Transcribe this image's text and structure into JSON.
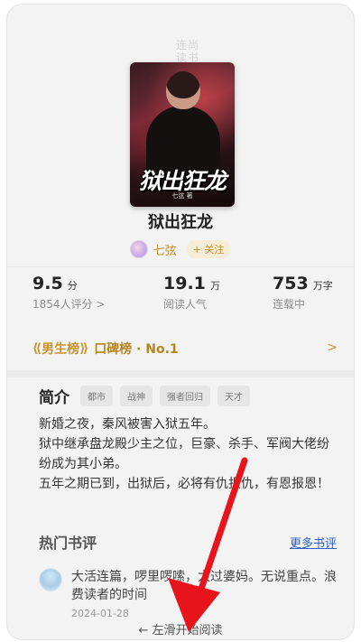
{
  "watermark": {
    "line1": "连尚",
    "line2": "读书"
  },
  "book": {
    "title": "狱出狂龙",
    "cover": {
      "title_art": "狱出狂龙",
      "author_art": "七弦 著"
    },
    "author": "七弦",
    "follow_label": "+ 关注"
  },
  "stats": {
    "rating": {
      "value": "9.5",
      "unit": "分",
      "label": "1854人评分 >"
    },
    "readers": {
      "value": "19.1",
      "unit": "万",
      "label": "阅读人气"
    },
    "words": {
      "value": "753",
      "unit": "万字",
      "label": "连载中"
    }
  },
  "ranking": {
    "laurel_left": "⟪",
    "list": "男生榜",
    "laurel_right": "⟫",
    "text": "口碑榜 · No.1",
    "chevron": ">"
  },
  "intro": {
    "title": "简介",
    "tags": [
      "都市",
      "战神",
      "强者回归",
      "天才"
    ],
    "paragraphs": [
      "新婚之夜，秦风被害入狱五年。",
      "狱中继承盘龙殿少主之位，巨豪、杀手、军阀大佬纷纷成为其小弟。",
      "五年之期已到，出狱后，必将有仇报仇，有恩报恩！"
    ]
  },
  "reviews": {
    "title": "热门书评",
    "more_label": "更多书评",
    "items": [
      {
        "text": "大活连篇，啰里啰嗦，太过婆妈。无说重点。浪费读者的时间",
        "date": "2024-01-28"
      }
    ]
  },
  "swipe_hint": "← 左滑开始阅读",
  "colors": {
    "accent_gold": "#c1902e",
    "link_blue": "#2f62c9",
    "arrow_red": "#e8141c"
  }
}
